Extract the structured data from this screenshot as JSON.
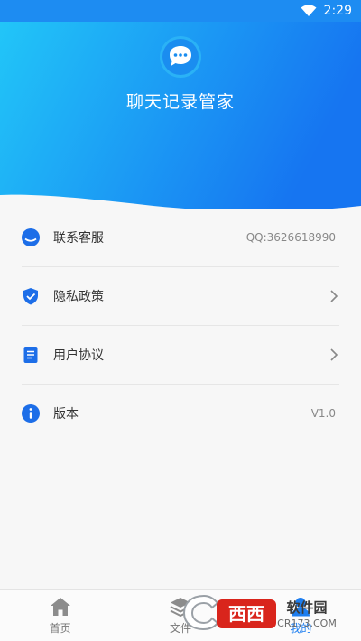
{
  "status_bar": {
    "time": "2:29"
  },
  "header": {
    "app_title": "聊天记录管家",
    "logo_icon": "chat-bubble-icon"
  },
  "menu": [
    {
      "label": "联系客服",
      "value": "QQ:3626618990",
      "icon": "customer-service-icon",
      "chevron": false
    },
    {
      "label": "隐私政策",
      "value": "",
      "icon": "shield-check-icon",
      "chevron": true
    },
    {
      "label": "用户协议",
      "value": "",
      "icon": "document-icon",
      "chevron": true
    },
    {
      "label": "版本",
      "value": "V1.0",
      "icon": "info-icon",
      "chevron": false
    }
  ],
  "tabbar": {
    "tabs": [
      {
        "label": "首页",
        "icon": "home-icon"
      },
      {
        "label": "文件",
        "icon": "layers-icon"
      },
      {
        "label": "我的",
        "icon": "user-icon"
      }
    ]
  },
  "watermark": {
    "brand": "西西软件园",
    "site": "CR173.COM"
  },
  "colors": {
    "accent": "#1d7ef0",
    "gradient_start": "#22c6f7",
    "gradient_end": "#1677f2"
  }
}
